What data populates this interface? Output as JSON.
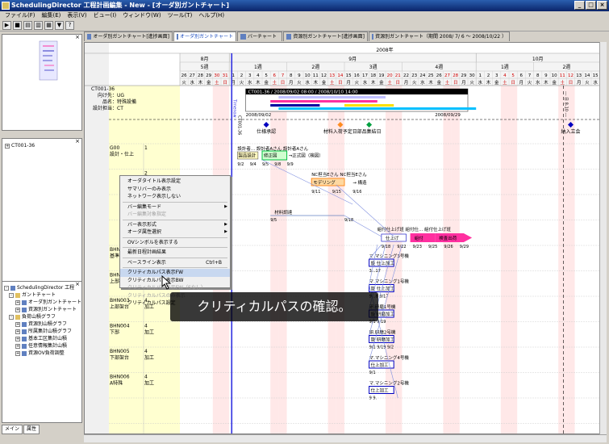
{
  "app": {
    "title": "SchedulingDirector 工程計画編集 - New - [オーダ別ガントチャート]"
  },
  "menu": [
    "ファイル(F)",
    "編集(E)",
    "表示(V)",
    "ビュー(I)",
    "ウィンドウ(W)",
    "ツール(T)",
    "ヘルプ(H)"
  ],
  "doc_tabs": [
    {
      "label": "オーダ別ガントチャート[進捗画面]",
      "active": false
    },
    {
      "label": "オーダ別ガントチャート",
      "active": true
    },
    {
      "label": "バーチャート",
      "active": false
    },
    {
      "label": "資源別ガントチャート[進捗画面]",
      "active": false
    },
    {
      "label": "資源別ガントチャート（期間 2008/ 7/ 6 ～ 2008/10/22 ）",
      "active": false
    }
  ],
  "left_panel": {
    "middle_tree_item": "CT001-36",
    "tree": [
      {
        "label": "SchedulingDirector 工程",
        "level": 0
      },
      {
        "label": "ガントチャート",
        "level": 1
      },
      {
        "label": "オーダ別ガントチャート",
        "level": 2
      },
      {
        "label": "資源別ガントチャート",
        "level": 2
      },
      {
        "label": "負荷山積グラフ",
        "level": 1
      },
      {
        "label": "資源別山積グラフ",
        "level": 2
      },
      {
        "label": "所属集計山積グラフ",
        "level": 2
      },
      {
        "label": "基本工区集計山積",
        "level": 2
      },
      {
        "label": "任意情報集計山積",
        "level": 2
      },
      {
        "label": "資源OV負荷調整",
        "level": 2
      }
    ],
    "bottom_tabs": [
      "メイン",
      "属性"
    ]
  },
  "timeline": {
    "year": "2008年",
    "months": [
      "8月",
      "9月",
      "10月"
    ],
    "weeks": [
      "5週",
      "1週",
      "2週",
      "3週",
      "4週",
      "1週",
      "2週"
    ],
    "days": [
      "26",
      "27",
      "28",
      "29",
      "30",
      "31",
      "1",
      "2",
      "3",
      "4",
      "5",
      "6",
      "7",
      "8",
      "9",
      "10",
      "11",
      "12",
      "13",
      "14",
      "15",
      "16",
      "17",
      "18",
      "19",
      "20",
      "21",
      "22",
      "23",
      "24",
      "25",
      "26",
      "27",
      "28",
      "29",
      "30",
      "1",
      "2",
      "3",
      "4",
      "5",
      "6",
      "7",
      "8",
      "9",
      "10",
      "11",
      "12",
      "13",
      "14",
      "15"
    ],
    "weekdays": [
      "火",
      "水",
      "木",
      "金",
      "土",
      "日",
      "月",
      "火",
      "水",
      "木",
      "金",
      "土",
      "日",
      "月",
      "火",
      "水",
      "木",
      "金",
      "土",
      "日",
      "月",
      "火",
      "水",
      "木",
      "金",
      "土",
      "日",
      "月",
      "火",
      "水",
      "木",
      "金",
      "土",
      "日",
      "月",
      "火",
      "水",
      "木",
      "金",
      "土",
      "日",
      "月",
      "火",
      "水",
      "木",
      "金",
      "土",
      "日",
      "月",
      "火",
      "水"
    ],
    "today_marker": "Timenow",
    "dash_marker": "--- 日 8-10 ---"
  },
  "order": {
    "id": "CT001-36",
    "dest": "向け先：UG",
    "product": "品名：特殊設備",
    "person": "設計担当：CT",
    "bar_label": "CT001-36 / 2008/09/02 08:00 / 2008/10/10 14:00",
    "start_date": "2008/09/02",
    "end_date": "2008/09/29"
  },
  "milestones": [
    {
      "label": "仕様承認"
    },
    {
      "label": "材料入荷予定日"
    },
    {
      "label": "部品集結日"
    },
    {
      "label": "納入立会"
    }
  ],
  "rows": [
    {
      "code": "G00",
      "name": "設計・仕上",
      "qty": "1"
    },
    {
      "code": "",
      "name": "",
      "qty": "2"
    },
    {
      "code": "",
      "name": "",
      "qty": "3"
    },
    {
      "code": "",
      "name": "",
      "qty": "4"
    },
    {
      "code": "BHN0",
      "name": "基準",
      "qty": ""
    },
    {
      "code": "BHN0",
      "name": "上部",
      "qty": ""
    },
    {
      "code": "BHN003",
      "name": "上部架台",
      "qty": "4"
    },
    {
      "code": "BHN004",
      "name": "下部",
      "qty": "4"
    },
    {
      "code": "BHN005",
      "name": "下部架台",
      "qty": "4"
    },
    {
      "code": "BHN006",
      "name": "A特殊",
      "qty": "4"
    }
  ],
  "row_types": [
    "加工",
    "加工",
    "加工",
    "加工"
  ],
  "tasks": {
    "design": {
      "title": "設計者...  設計者Aさん  設計者Aさん",
      "boxes": [
        "製品設計",
        "修正図",
        "→正式図（検図）"
      ],
      "dates": [
        "9/2",
        "9/4",
        "9/5",
        "9/8",
        "9/9"
      ]
    },
    "nc": {
      "title": "NC担当Eさん  NC担当Eさん",
      "boxes": [
        "モデリング",
        "→ 構造"
      ],
      "dates": [
        "9/11",
        "9/15",
        "9/16"
      ]
    },
    "material": {
      "title": "材料調達",
      "dates": [
        "9/5",
        "9/18"
      ]
    },
    "finish": {
      "title": "組付仕上げ班  組付仕...  組付仕上げ班",
      "boxes": [
        "仕上げ",
        "組付",
        "検査出荷"
      ],
      "dates": [
        "9/18",
        "9/22",
        "9/23",
        "9/25",
        "9/26",
        "9/29"
      ]
    },
    "machining": [
      {
        "title": "マ.マシニング3号機",
        "box": "旋 仕上加工",
        "dates": "3...17"
      },
      {
        "title": "マ.マシニング1号機",
        "box": "旋 仕上加工",
        "dates": "9...8 9/17"
      },
      {
        "title": "研.研磨1号機",
        "box": "旋 研磨加工",
        "dates": "9/1 9/19"
      },
      {
        "title": "研.研磨2号機",
        "box": "旋 研磨加工",
        "dates": "9/1 9/19 9/2"
      },
      {
        "title": "マ.マシニング4号機",
        "box": "仕上加工",
        "dates": "9/1"
      },
      {
        "title": "マ.マシニング2号機",
        "box": "仕上加工",
        "dates": "9 9."
      }
    ]
  },
  "context_menu": [
    {
      "label": "オーダタイトル表示設定",
      "enabled": true
    },
    {
      "label": "サマリバーのみ表示",
      "enabled": true
    },
    {
      "label": "ネットワーク表示しない",
      "enabled": true
    },
    {
      "sep": true
    },
    {
      "label": "バー編集モード",
      "enabled": true,
      "sub": true
    },
    {
      "label": "バー編集対象指定",
      "enabled": false
    },
    {
      "sep": true
    },
    {
      "label": "バー表示形式",
      "enabled": true,
      "sub": true
    },
    {
      "label": "オーダ属性選択",
      "enabled": true,
      "sub": true
    },
    {
      "sep": true
    },
    {
      "label": "OVシンボルを表示する",
      "enabled": true
    },
    {
      "sep": true
    },
    {
      "label": "最新日程計画結果",
      "enabled": true
    },
    {
      "sep": true
    },
    {
      "label": "ベースライン表示",
      "enabled": true,
      "shortcut": "Ctrl+B"
    },
    {
      "sep": true
    },
    {
      "label": "クリティカルパス表示FW",
      "enabled": true,
      "selected": true
    },
    {
      "label": "クリティカルパス表示BW",
      "enabled": true
    },
    {
      "label": "クリティカルパス表示FW（Sなし）",
      "enabled": false
    },
    {
      "label": "クリティカルパスのみ表示",
      "enabled": false
    },
    {
      "label": "クリティカルパス設定",
      "enabled": true
    }
  ],
  "caption": "クリティカルパスの確認。",
  "colors": {
    "accent_blue": "#0000c0",
    "timenow": "#3030e0",
    "row_bg": "#ffffd0",
    "weekend_bg": "#ffe8e8",
    "critical_pink": "#ff30a0",
    "orange": "#ff8c20"
  }
}
